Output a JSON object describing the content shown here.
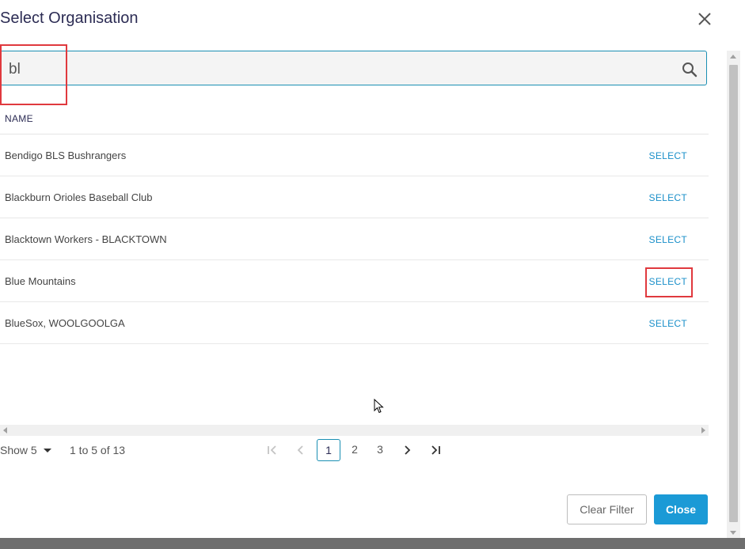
{
  "dialog": {
    "title": "Select Organisation"
  },
  "search": {
    "value": "bl"
  },
  "table": {
    "column_header": "NAME",
    "rows": [
      {
        "name": "Bendigo BLS Bushrangers",
        "action": "SELECT"
      },
      {
        "name": "Blackburn Orioles Baseball Club",
        "action": "SELECT"
      },
      {
        "name": "Blacktown Workers - BLACKTOWN",
        "action": "SELECT"
      },
      {
        "name": "Blue Mountains",
        "action": "SELECT"
      },
      {
        "name": "BlueSox, WOOLGOOLGA",
        "action": "SELECT"
      }
    ]
  },
  "pagination": {
    "show_label": "Show 5",
    "range_label": "1 to 5 of 13",
    "pages": [
      "1",
      "2",
      "3"
    ],
    "current_page": "1"
  },
  "footer": {
    "clear_filter_label": "Clear Filter",
    "close_label": "Close"
  },
  "colors": {
    "accent": "#1a8fb3",
    "primary_button": "#1b9ad6",
    "highlight_box": "#e0393e",
    "title_text": "#2c2c54"
  }
}
